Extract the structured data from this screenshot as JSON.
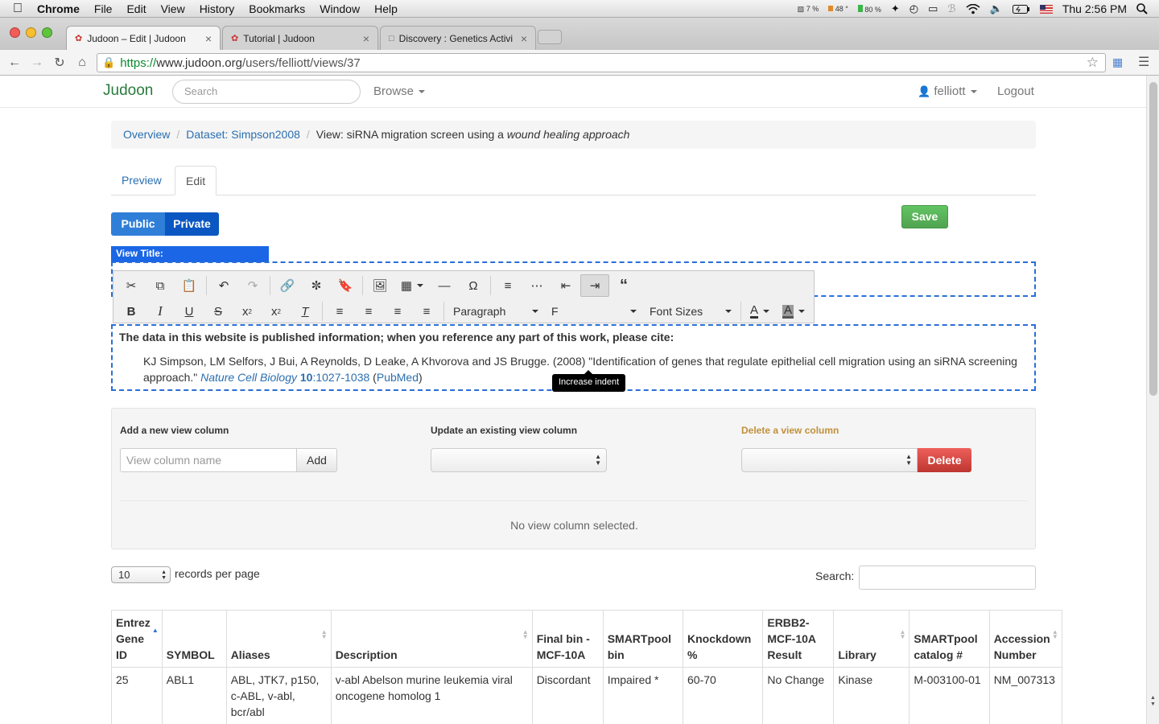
{
  "menubar": {
    "app": "Chrome",
    "items": [
      "File",
      "Edit",
      "View",
      "History",
      "Bookmarks",
      "Window",
      "Help"
    ],
    "status": {
      "cpu": "7 %",
      "temp": "48 °",
      "battery_pct": "80 %",
      "clock": "Thu 2:56 PM"
    }
  },
  "browser": {
    "tabs": [
      {
        "title": "Judoon – Edit | Judoon",
        "active": true
      },
      {
        "title": "Tutorial | Judoon",
        "active": false
      },
      {
        "title": "Discovery : Genetics Activi",
        "active": false
      }
    ],
    "url_scheme": "https://",
    "url_host": "www.judoon.org",
    "url_path": "/users/felliott/views/37"
  },
  "navbar": {
    "brand": "Judoon",
    "search_placeholder": "Search",
    "browse": "Browse",
    "user": "felliott",
    "logout": "Logout"
  },
  "breadcrumb": {
    "overview": "Overview",
    "dataset": "Dataset: Simpson2008",
    "view_prefix": "View: siRNA migration screen using a ",
    "view_em": "wound healing approach"
  },
  "tabs": {
    "preview": "Preview",
    "edit": "Edit"
  },
  "visibility": {
    "public": "Public",
    "private": "Private"
  },
  "save_label": "Save",
  "editor": {
    "view_title_label": "View Title:",
    "paragraph_select": "Paragraph",
    "font_family_partial": "F",
    "font_sizes_select": "Font Sizes",
    "tooltip": "Increase indent",
    "colors": {
      "text_color": "#333333",
      "bg_color": "#555555"
    }
  },
  "citation": {
    "lead": "The data in this website is published information; when you reference any part of this work, please cite:",
    "authors": "KJ Simpson, LM Selfors, J Bui, A Reynolds, D Leake, A Khvorova and JS Brugge. (2008) \"Identification of genes that regulate epithelial cell migration using an siRNA screening approach.\" ",
    "journal": "Nature Cell Biology",
    "volume": "10",
    "pages": ":1027-1038",
    "open_paren": " (",
    "pubmed": "PubMed",
    "close_paren": ")"
  },
  "columns_panel": {
    "add_label": "Add a new view column",
    "add_placeholder": "View column name",
    "add_button": "Add",
    "update_label": "Update an existing view column",
    "delete_label": "Delete a view column",
    "delete_button": "Delete",
    "empty_message": "No view column selected."
  },
  "table_controls": {
    "records_per_page_value": "10",
    "records_per_page_label": "records per page",
    "search_label": "Search:"
  },
  "table": {
    "headers": [
      [
        "Entrez",
        "Gene",
        "ID"
      ],
      [
        "SYMBOL"
      ],
      [
        "Aliases"
      ],
      [
        "Description"
      ],
      [
        "Final bin -",
        "MCF-10A"
      ],
      [
        "SMARTpool",
        "bin"
      ],
      [
        "Knockdown",
        "%"
      ],
      [
        "ERBB2-",
        "MCF-10A",
        "Result"
      ],
      [
        "Library"
      ],
      [
        "SMARTpool",
        "catalog #"
      ],
      [
        "Accession",
        "Number"
      ]
    ],
    "rows": [
      [
        "25",
        "ABL1",
        "ABL, JTK7, p150, c-ABL, v-abl, bcr/abl",
        "v-abl Abelson murine leukemia viral oncogene homolog 1",
        "Discordant",
        "Impaired *",
        "60-70",
        "No Change",
        "Kinase",
        "M-003100-01",
        "NM_007313"
      ]
    ]
  },
  "accent_colors": {
    "link": "#2a6fb0",
    "brand": "#2a7a3c",
    "save": "#51a351",
    "delete": "#bd362f",
    "public": "#2f7fd8",
    "private": "#0a57c2",
    "editor_dash": "#2a6fd6"
  }
}
